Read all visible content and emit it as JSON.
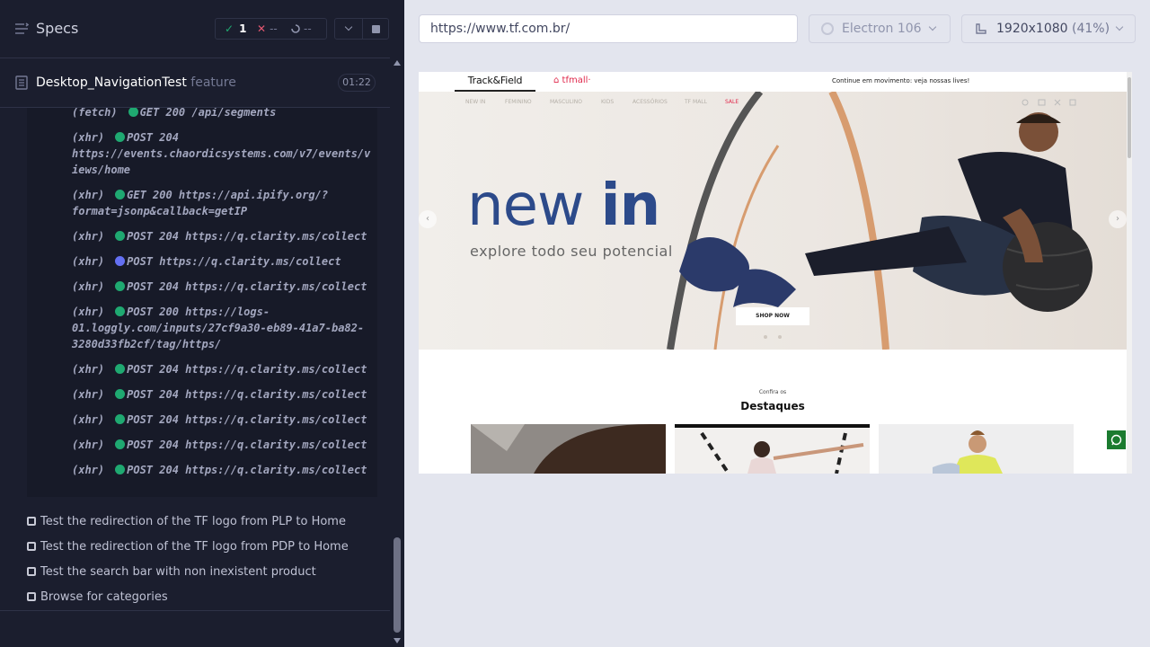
{
  "reporter": {
    "title": "Specs",
    "stats": {
      "passed": "1",
      "failed": "--",
      "pending": "--"
    },
    "spec_file": {
      "name": "Desktop_NavigationTest",
      "extension": "feature",
      "duration": "01:22"
    },
    "logs": [
      {
        "type": "(fetch)",
        "status": "green",
        "lines": [
          "GET 200 /api/segments"
        ]
      },
      {
        "type": "(xhr)",
        "status": "green",
        "lines": [
          "POST 204",
          "https://events.chaordicsystems.com/v7/events/v",
          "iews/home"
        ]
      },
      {
        "type": "(xhr)",
        "status": "green",
        "lines": [
          "GET 200 https://api.ipify.org/?",
          "format=jsonp&callback=getIP"
        ]
      },
      {
        "type": "(xhr)",
        "status": "green",
        "lines": [
          "POST 204 https://q.clarity.ms/collect"
        ]
      },
      {
        "type": "(xhr)",
        "status": "blue",
        "lines": [
          "POST https://q.clarity.ms/collect"
        ]
      },
      {
        "type": "(xhr)",
        "status": "green",
        "lines": [
          "POST 204 https://q.clarity.ms/collect"
        ]
      },
      {
        "type": "(xhr)",
        "status": "green",
        "lines": [
          "POST 200 https://logs-",
          "01.loggly.com/inputs/27cf9a30-eb89-41a7-ba82-",
          "3280d33fb2cf/tag/https/"
        ]
      },
      {
        "type": "(xhr)",
        "status": "green",
        "lines": [
          "POST 204 https://q.clarity.ms/collect"
        ]
      },
      {
        "type": "(xhr)",
        "status": "green",
        "lines": [
          "POST 204 https://q.clarity.ms/collect"
        ]
      },
      {
        "type": "(xhr)",
        "status": "green",
        "lines": [
          "POST 204 https://q.clarity.ms/collect"
        ]
      },
      {
        "type": "(xhr)",
        "status": "green",
        "lines": [
          "POST 204 https://q.clarity.ms/collect"
        ]
      },
      {
        "type": "(xhr)",
        "status": "green",
        "lines": [
          "POST 204 https://q.clarity.ms/collect"
        ]
      }
    ],
    "tests": [
      "Test the redirection of the TF logo from PLP to Home",
      "Test the redirection of the TF logo from PDP to Home",
      "Test the search bar with non inexistent product",
      "Browse for categories"
    ]
  },
  "toolbar": {
    "url": "https://www.tf.com.br/",
    "browser": "Electron 106",
    "viewport": "1920x1080",
    "viewport_scale": "(41%)"
  },
  "site": {
    "tab_brand": "Track&Field",
    "tab_mall": "⌂ tfmall·",
    "promo": "Continue em movimento: veja nossas lives!",
    "nav": [
      "NEW IN",
      "FEMININO",
      "MASCULINO",
      "KIDS",
      "ACESSÓRIOS",
      "TF MALL",
      "SALE"
    ],
    "hero_title_light": "new",
    "hero_title_bold": "in",
    "hero_subtitle": "explore todo seu potencial",
    "hero_cta": "SHOP NOW",
    "section_small": "Confira os",
    "section_title": "Destaques"
  },
  "colors": {
    "passed": "#1fa971",
    "failed": "#e45770",
    "request_pending": "#6470f3",
    "brand_blue": "#2c4a8a",
    "sale_red": "#e0284b"
  }
}
